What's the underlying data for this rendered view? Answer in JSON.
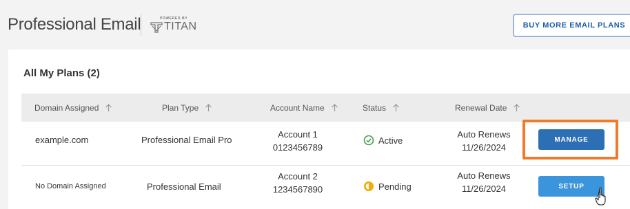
{
  "header": {
    "title": "Professional Email",
    "powered_by": "POWERED BY",
    "brand": "TITAN",
    "buy_button": "BUY MORE EMAIL PLANS"
  },
  "plans": {
    "title": "All My Plans (2)",
    "columns": [
      "Domain Assigned",
      "Plan Type",
      "Account Name",
      "Status",
      "Renewal Date"
    ],
    "rows": [
      {
        "domain": "example.com",
        "plan_type": "Professional Email Pro",
        "account_name": "Account 1",
        "account_number": "0123456789",
        "status": "Active",
        "renewal_line1": "Auto Renews",
        "renewal_line2": "11/26/2024",
        "action": "MANAGE"
      },
      {
        "domain": "No Domain Assigned",
        "plan_type": "Professional Email",
        "account_name": "Account 2",
        "account_number": "1234567890",
        "status": "Pending",
        "renewal_line1": "Auto Renews",
        "renewal_line2": "11/26/2024",
        "action": "SETUP"
      }
    ]
  },
  "colors": {
    "active": "#43a047",
    "pending": "#f2a900",
    "manage_button": "#2d6fb5",
    "setup_button": "#3b95dc",
    "highlight": "#f07a2c"
  },
  "icons": {
    "sort": "arrow-up-icon",
    "active": "check-circle-icon",
    "pending": "pending-clock-icon",
    "cursor": "hand-pointer-icon"
  }
}
